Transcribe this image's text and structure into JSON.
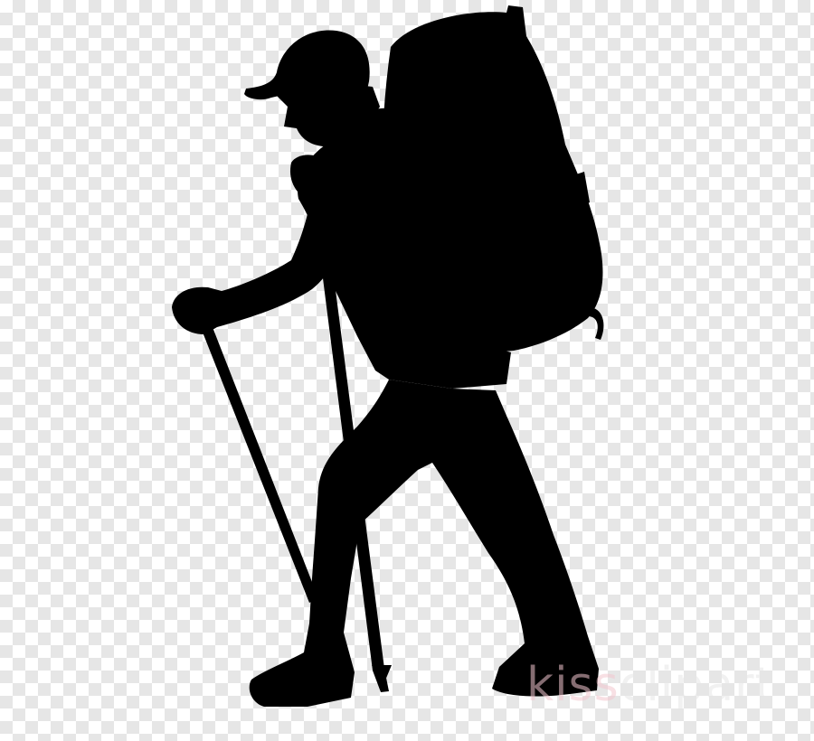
{
  "image": {
    "subject": "hiker-silhouette",
    "background": "transparency-checkerboard",
    "colors": {
      "silhouette": "#000000",
      "checker_light": "#ffffff",
      "checker_dark": "#e6e6e6",
      "watermark_accent": "#f3c7cf",
      "watermark_gray": "#e6e6e6"
    }
  },
  "watermark": {
    "part_a": "kiss",
    "part_b": "clipart"
  }
}
